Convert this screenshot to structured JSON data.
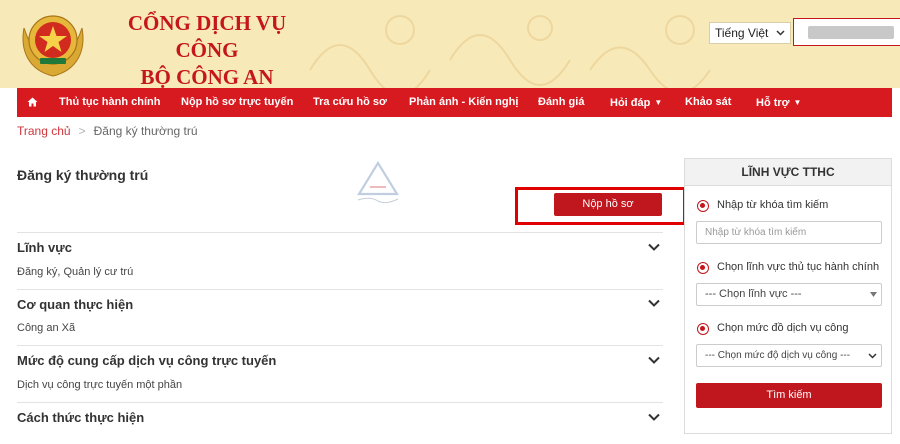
{
  "header": {
    "title_line1": "CỔNG DỊCH VỤ CÔNG",
    "title_line2": "BỘ CÔNG AN",
    "language": "Tiếng Việt",
    "colors": {
      "accent": "#d71920",
      "title": "#c4161c",
      "header_bg": "#f8e9b8"
    }
  },
  "nav": {
    "home_icon": "home-icon",
    "items": [
      {
        "label": "Thủ tục hành chính",
        "has_dropdown": false
      },
      {
        "label": "Nộp hồ sơ trực tuyến",
        "has_dropdown": false
      },
      {
        "label": "Tra cứu hồ sơ",
        "has_dropdown": false
      },
      {
        "label": "Phản ánh - Kiến nghị",
        "has_dropdown": false
      },
      {
        "label": "Đánh giá",
        "has_dropdown": false
      },
      {
        "label": "Hỏi đáp",
        "has_dropdown": true
      },
      {
        "label": "Khảo sát",
        "has_dropdown": false
      },
      {
        "label": "Hỗ trợ",
        "has_dropdown": true
      }
    ]
  },
  "breadcrumb": {
    "home": "Trang chủ",
    "separator": ">",
    "current": "Đăng ký thường trú"
  },
  "main": {
    "title": "Đăng ký thường trú",
    "submit_label": "Nộp hồ sơ",
    "sections": [
      {
        "title": "Lĩnh vực",
        "value": "Đăng ký, Quản lý cư trú"
      },
      {
        "title": "Cơ quan thực hiện",
        "value": "Công an Xã"
      },
      {
        "title": "Mức độ cung cấp dịch vụ công trực tuyến",
        "value": "Dịch vụ công trực tuyến một phần"
      },
      {
        "title": "Cách thức thực hiện",
        "value": ""
      }
    ]
  },
  "sidebar": {
    "title": "LĨNH VỰC TTHC",
    "keyword_label": "Nhập từ khóa tìm kiếm",
    "keyword_placeholder": "Nhập từ khóa tìm kiếm",
    "field_label": "Chọn lĩnh vực thủ tục hành chính",
    "field_select": "--- Chọn lĩnh vực ---",
    "level_label": "Chọn mức đồ dịch vụ công",
    "level_select": "--- Chọn mức độ dịch vụ công ---",
    "search_button": "Tìm kiếm"
  }
}
